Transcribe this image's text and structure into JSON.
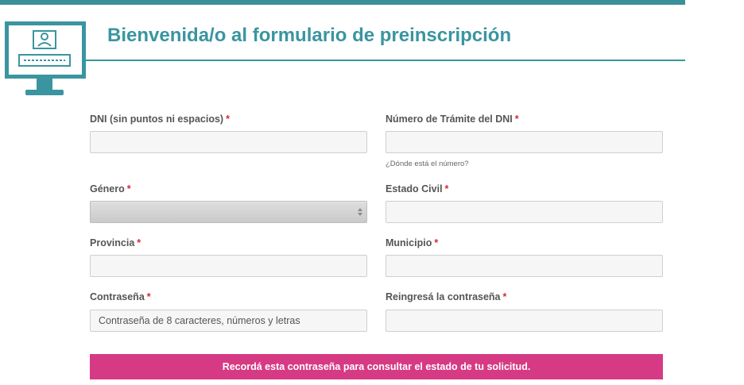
{
  "header": {
    "title": "Bienvenida/o al formulario de preinscripción",
    "icon": "computer-monitor-user-icon",
    "accent_color": "#3a95a0"
  },
  "form": {
    "required_marker": "*",
    "required_color": "#d9263a",
    "dni": {
      "label": "DNI (sin puntos ni espacios)",
      "value": ""
    },
    "tramite": {
      "label": "Número de Trámite del DNI",
      "value": "",
      "hint": "¿Dónde está el número?"
    },
    "genero": {
      "label": "Género",
      "selected": ""
    },
    "estado_civil": {
      "label": "Estado Civil",
      "value": ""
    },
    "provincia": {
      "label": "Provincia",
      "value": ""
    },
    "municipio": {
      "label": "Municipio",
      "value": ""
    },
    "password": {
      "label": "Contraseña",
      "placeholder": "Contraseña de 8 caracteres, números y letras"
    },
    "password_repeat": {
      "label": "Reingresá la contraseña",
      "value": ""
    }
  },
  "banner": {
    "text": "Recordá esta contraseña para consultar el estado de tu solicitud.",
    "color": "#d63a84"
  }
}
